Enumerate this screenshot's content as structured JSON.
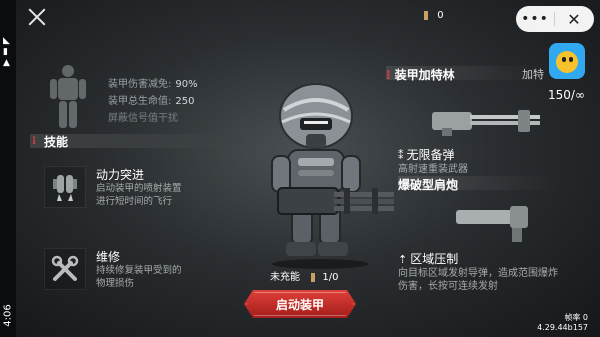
{
  "status": {
    "time": "4:06"
  },
  "header": {
    "ammo_count": "0"
  },
  "capsule": {
    "more": "•••",
    "close": "✕"
  },
  "right_panel": {
    "ammo_total": "150/∞"
  },
  "stats": {
    "row1_label": "装甲伤害减免:",
    "row1_value": "90%",
    "row2_label": "装甲总生命值:",
    "row2_value": "250",
    "row3_label": "屏蔽信号值干扰"
  },
  "skills_section": {
    "title": "技能",
    "marker": "⁝"
  },
  "skills": [
    {
      "name": "动力突进",
      "desc_line1": "启动装甲的喷射装置",
      "desc_line2": "进行短时间的飞行",
      "icon": "jetpack-icon"
    },
    {
      "name": "维修",
      "desc_line1": "持续修复装甲受到的",
      "desc_line2": "物理损伤",
      "icon": "wrench-icon"
    }
  ],
  "charge": {
    "label": "未充能",
    "value": "1/0"
  },
  "start_button": {
    "label": "启动装甲"
  },
  "weapons": [
    {
      "name": "装甲加特林",
      "tag": "加特",
      "icon": "gatling-gun-icon"
    },
    {
      "name": "爆破型肩炮",
      "icon": "shoulder-cannon-icon"
    }
  ],
  "right_skills": [
    {
      "name": "无限备弹",
      "desc": "高射速重装武器",
      "icon": "infinite-ammo-icon"
    },
    {
      "name": "区域压制",
      "desc_line1": "向目标区域发射导弹，造成范围爆炸",
      "desc_line2": "伤害，长按可连续发射",
      "icon": "missile-icon"
    }
  ],
  "footer": {
    "frame_rate": "帧率 0",
    "version": "4.29.44b157"
  },
  "colors": {
    "accent_red": "#e03b3b",
    "button_red": "#c42d28"
  }
}
